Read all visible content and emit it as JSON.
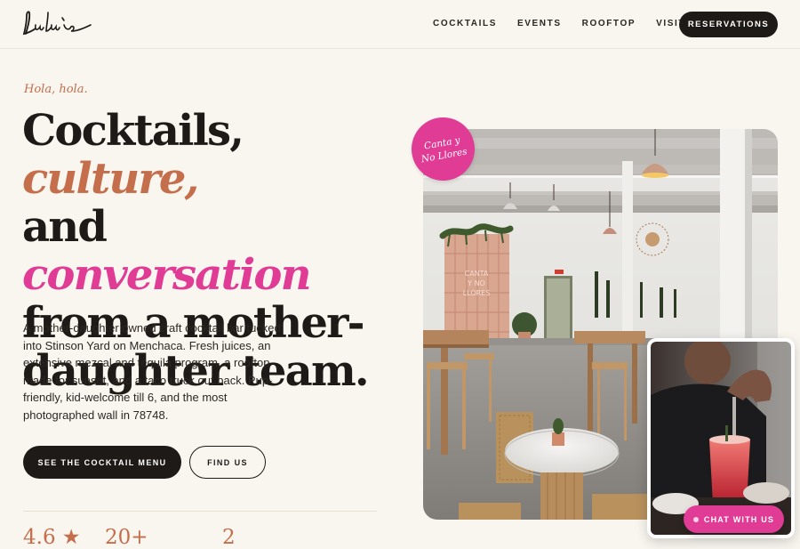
{
  "header": {
    "brand": "Lulu's",
    "nav": [
      "COCKTAILS",
      "EVENTS",
      "ROOFTOP",
      "VISIT"
    ],
    "reservations_label": "RESERVATIONS"
  },
  "hero": {
    "kicker": "Hola, hola.",
    "headline": {
      "part1": "Cocktails, ",
      "accent1": "culture,",
      "part2": "and ",
      "accent2": "conversation",
      "part3": "from a mother-daughter team."
    },
    "description": "A mother-daughter owned craft cocktail bar tucked into Stinson Yard on Menchaca. Fresh juices, an extensive mezcal and tequila program, a rooftop made for sunset, and a taco truck out back. Pup-friendly, kid-welcome till 6, and the most photographed wall in 78748.",
    "cta_primary": "SEE THE COCKTAIL MENU",
    "cta_secondary": "FIND US"
  },
  "stats": [
    "4.6 ★",
    "20+",
    "2"
  ],
  "badge": {
    "line1": "Canta y",
    "line2": "No Llores"
  },
  "photo_sign": {
    "line1": "CANTA",
    "line2": "Y NO",
    "line3": "LLORES"
  },
  "chat": {
    "label": "CHAT WITH US"
  },
  "colors": {
    "background": "#f9f5ef",
    "ink": "#1e1a17",
    "terracotta": "#c46e4b",
    "pink": "#e03c95"
  }
}
